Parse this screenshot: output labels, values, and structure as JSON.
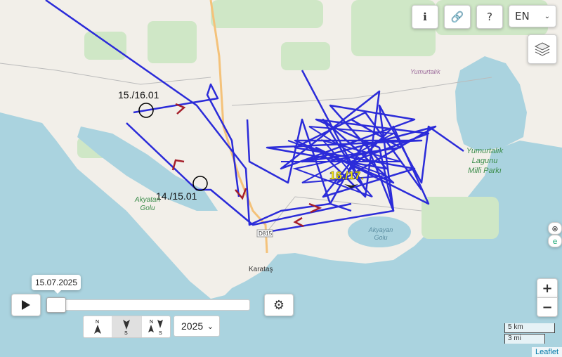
{
  "toolbar": {
    "info_icon": "info-icon",
    "link_icon": "link-icon",
    "help_icon": "help-icon",
    "language": "EN",
    "layers_icon": "layers-icon"
  },
  "map": {
    "place_labels": {
      "yumurtalik": "Yumurtalık",
      "lagoon_park": "Yumurtalık\nLagunu\nMilli Parkı",
      "akyatan": "Akyatan\nGolu",
      "akyayan": "Akyayan\nGolu",
      "karatas": "Karataş",
      "road": "D815"
    },
    "annotations": {
      "night1": "15./16.01",
      "night2": "14./15.01",
      "night3": "16./17."
    },
    "colors": {
      "sea": "#aad3df",
      "land": "#f2efe9",
      "green": "#cfe7c6",
      "track": "#2b2bd9",
      "arrow": "#a51f2a",
      "highlight": "#ffee00"
    }
  },
  "playback": {
    "date": "15.07.2025",
    "play_icon": "play-icon",
    "settings_icon": "gear-icon",
    "year": "2025",
    "north_options": [
      "N",
      "S",
      "NS"
    ]
  },
  "zoom": {
    "in": "+",
    "out": "−"
  },
  "scale": {
    "km": "5 km",
    "mi": "3 mi"
  },
  "attribution": "Leaflet"
}
